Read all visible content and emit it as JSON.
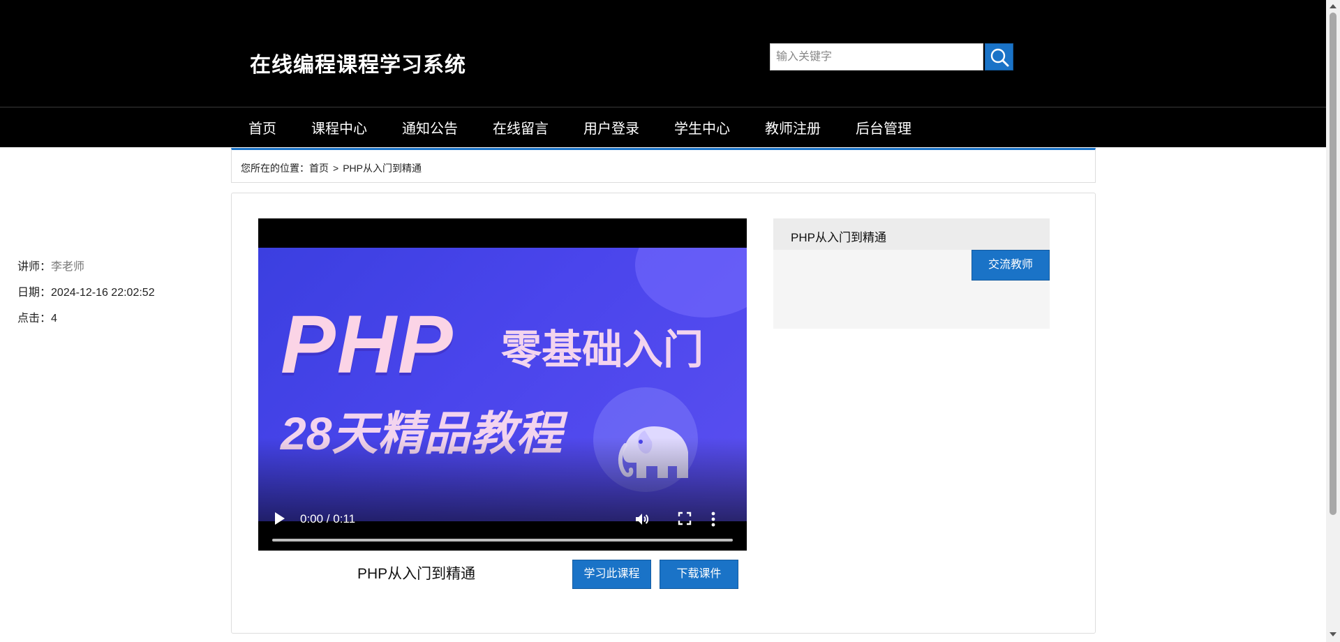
{
  "header": {
    "site_title": "在线编程课程学习系统",
    "search": {
      "placeholder": "输入关键字",
      "value": ""
    }
  },
  "nav": {
    "items": [
      {
        "label": "首页"
      },
      {
        "label": "课程中心"
      },
      {
        "label": "通知公告"
      },
      {
        "label": "在线留言"
      },
      {
        "label": "用户登录"
      },
      {
        "label": "学生中心"
      },
      {
        "label": "教师注册"
      },
      {
        "label": "后台管理"
      }
    ]
  },
  "breadcrumb": {
    "prefix": "您所在的位置：",
    "home": "首页",
    "separator": ">",
    "current": "PHP从入门到精通"
  },
  "video": {
    "poster": {
      "title_latin": "PHP",
      "title_cn": "零基础入门",
      "subtitle": "28天精品教程"
    },
    "time": "0:00 / 0:11",
    "progress_fraction": 0,
    "caption": "PHP从入门到精通"
  },
  "actions": {
    "study_label": "学习此课程",
    "download_label": "下载课件"
  },
  "info": {
    "title": "PHP从入门到精通",
    "teacher_label": "讲师：",
    "teacher_value": "李老师",
    "date_label": "日期：",
    "date_value": "2024-12-16 22:02:52",
    "clicks_label": "点击：",
    "clicks_value": "4",
    "contact_label": "交流教师"
  },
  "colors": {
    "header_bg": "#000000",
    "accent_blue": "#1a73c7",
    "poster_bg": "#4a45ec"
  }
}
